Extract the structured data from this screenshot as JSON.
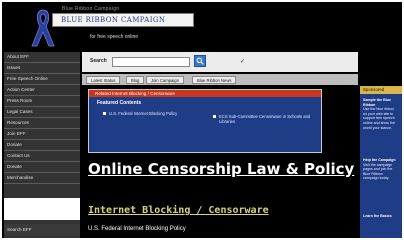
{
  "header": {
    "org_line": "Blue Ribbon Campaign",
    "banner": "BLUE RIBBON CAMPAIGN",
    "tagline": "for free speech online"
  },
  "search": {
    "label": "Search",
    "value": "",
    "extra": "✓"
  },
  "tabs": [
    {
      "label": "Latest Status"
    },
    {
      "label": "Blog"
    },
    {
      "label": "Join Campaign"
    },
    {
      "label": "Blue Ribbon News"
    }
  ],
  "leftnav": {
    "items": [
      {
        "label": "About EFF"
      },
      {
        "label": "Issues"
      },
      {
        "label": "Free Speech Online"
      },
      {
        "label": "Action Center"
      },
      {
        "label": "Press Room"
      },
      {
        "label": "Legal Cases"
      },
      {
        "label": "Resources"
      },
      {
        "label": "Join EFF"
      },
      {
        "label": "Donate"
      },
      {
        "label": "Contact Us"
      },
      {
        "label": "Donate"
      },
      {
        "label": "Merchandise"
      }
    ],
    "bottom_label": "Search EFF"
  },
  "related": {
    "title": "Related Internet Blocking / Censorware",
    "subtitle": "Featured Contents",
    "link_1": "U.S. Federal Internet Blocking Policy",
    "link_2": "ECS Sub-Committee Censorware in Schools and Libraries"
  },
  "main": {
    "title": "Online Censorship Law & Policy",
    "subheading": "Internet Blocking / Censorware",
    "subtext": "U.S. Federal Internet Blocking Policy"
  },
  "right": {
    "heading": "Sponsored",
    "block1_title": "Sample the Blue Ribbon",
    "block1_text": "Use the blue ribbon on your web site to support free speech online and show the world your stance.",
    "block2_title": "Help the Campaign",
    "block2_text": "Visit the campaign pages and join the Blue Ribbon campaign today.",
    "block3_title": "Learn the Basics"
  },
  "colors": {
    "nav_bg": "#333333",
    "accent_blue": "#1f3d86",
    "heading_red": "#c4381f",
    "subheading_gold": "#d7d37a"
  }
}
